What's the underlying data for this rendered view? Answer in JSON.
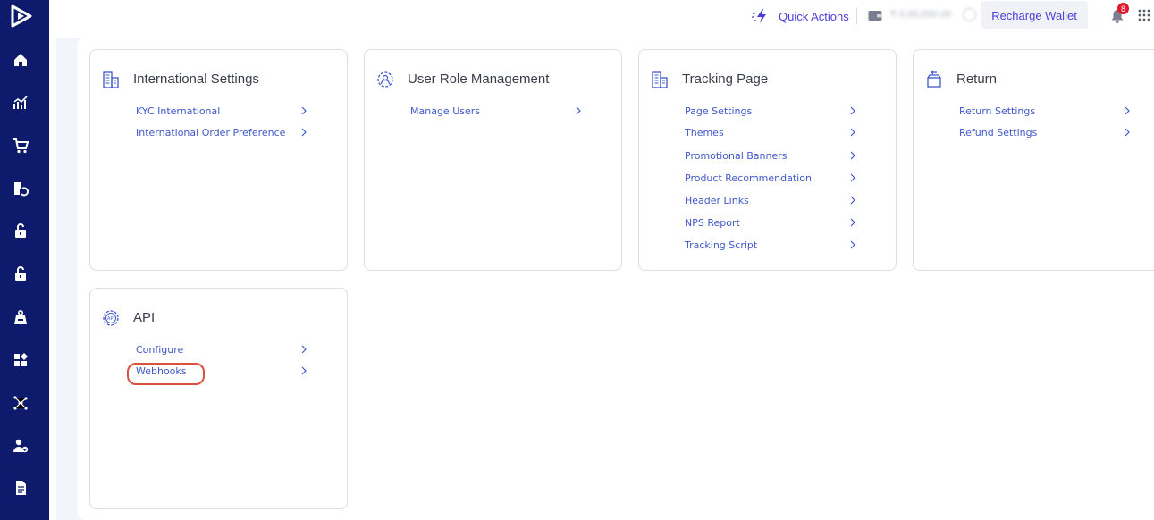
{
  "topbar": {
    "quick_actions_label": "Quick Actions",
    "wallet_balance": "₹ 0,00,000.00",
    "recharge_label": "Recharge Wallet",
    "notification_count": "8"
  },
  "sidebar": {
    "items": [
      "home-icon",
      "analytics-icon",
      "cart-icon",
      "returns-icon",
      "lock-icon",
      "lock-alt-icon",
      "weight-icon",
      "apps-icon",
      "network-icon",
      "user-check-icon",
      "document-icon"
    ]
  },
  "cards": [
    {
      "title": "International Settings",
      "icon": "building-icon",
      "links": [
        "KYC International",
        "International Order Preference"
      ]
    },
    {
      "title": "User Role Management",
      "icon": "user-gear-icon",
      "links": [
        "Manage Users"
      ]
    },
    {
      "title": "Tracking Page",
      "icon": "building-icon",
      "links": [
        "Page Settings",
        "Themes",
        "Promotional Banners",
        "Product Recommendation",
        "Header Links",
        "NPS Report",
        "Tracking Script"
      ]
    },
    {
      "title": "Return",
      "icon": "return-box-icon",
      "links": [
        "Return Settings",
        "Refund Settings"
      ]
    },
    {
      "title": "API",
      "icon": "api-gear-icon",
      "links": [
        "Configure",
        "Webhooks"
      ]
    }
  ],
  "colors": {
    "sidebar": "#0e1a6b",
    "accent": "#4b3fd6",
    "link": "#3f58c9",
    "highlight": "#d9523f"
  }
}
